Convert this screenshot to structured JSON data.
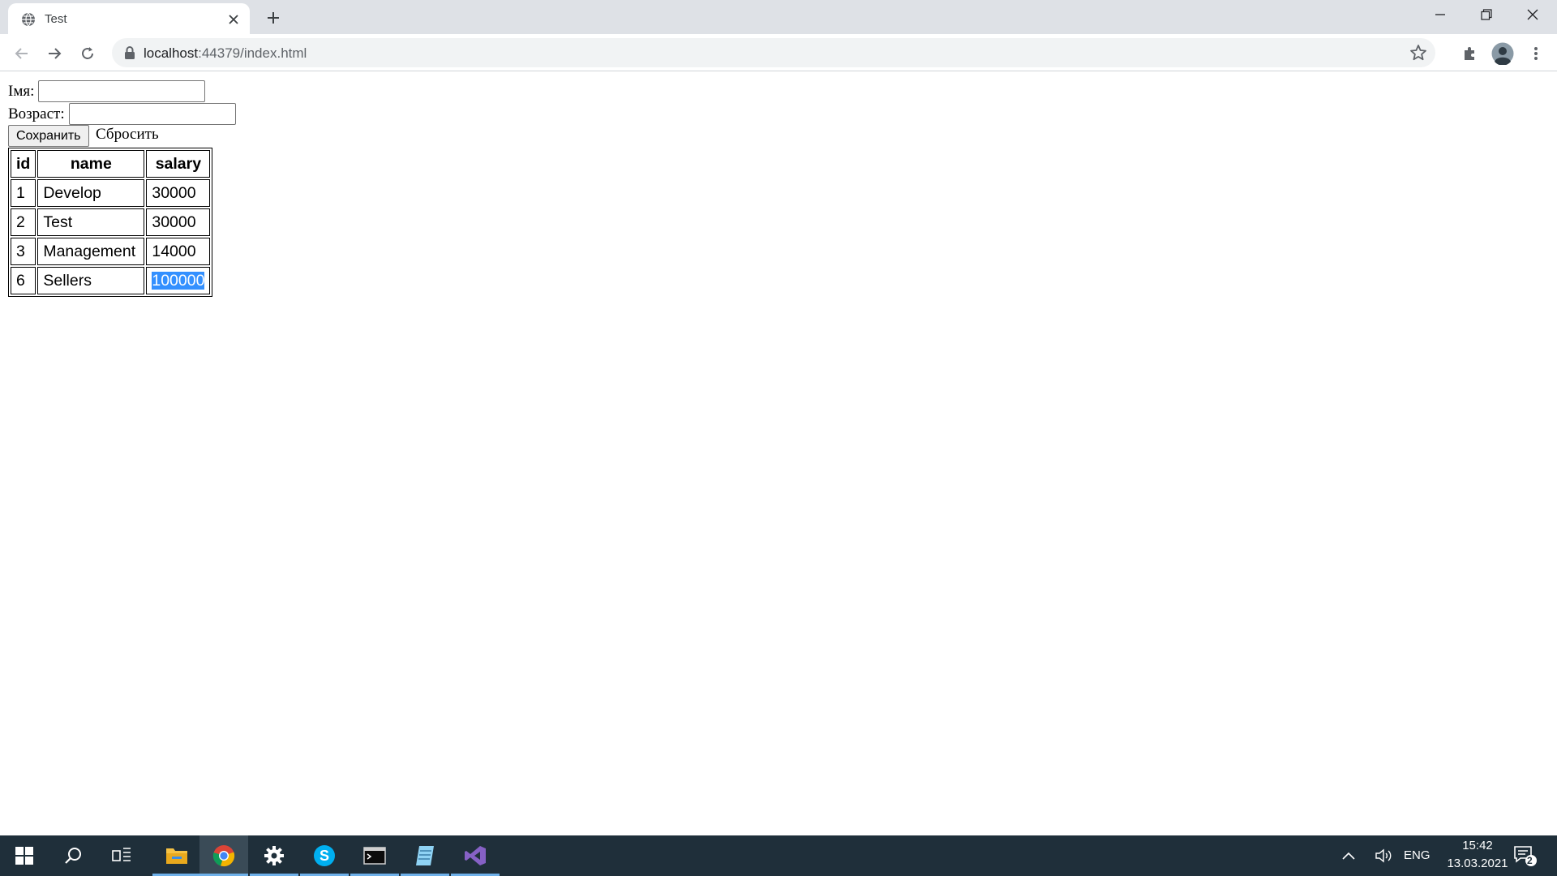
{
  "browser": {
    "tab_title": "Test",
    "url_host": "localhost",
    "url_rest": ":44379/index.html"
  },
  "form": {
    "name_label": "Імя:",
    "name_value": "",
    "age_label": "Возраст:",
    "age_value": "",
    "save_label": "Сохранить",
    "reset_label": "Сбросить"
  },
  "table": {
    "headers": [
      "id",
      "name",
      "salary"
    ],
    "rows": [
      [
        "1",
        "Develop",
        "30000"
      ],
      [
        "2",
        "Test",
        "30000"
      ],
      [
        "3",
        "Management",
        "14000"
      ],
      [
        "6",
        "Sellers",
        "100000"
      ]
    ]
  },
  "taskbar": {
    "language": "ENG",
    "time": "15:42",
    "date": "13.03.2021",
    "notification_count": "2"
  }
}
